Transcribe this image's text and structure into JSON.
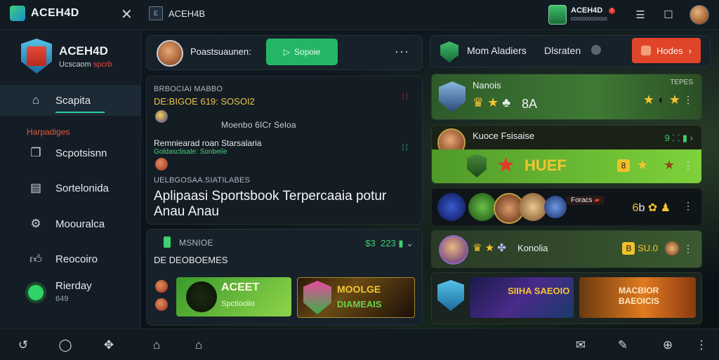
{
  "app": {
    "brand": "ACEH4D",
    "tab_title": "ACEH4B",
    "tab_icon": "E"
  },
  "topbar": {
    "account_name": "ACEH4D",
    "account_sub": "ccccccccccccc",
    "notif_count": "1",
    "icons": [
      "menu-icon",
      "window-icon",
      "profile-avatar"
    ]
  },
  "sidebar": {
    "title": "ACEH4D",
    "subtitle_main": "Ucscaom",
    "subtitle_accent": "spcrb",
    "section": "Harpadiges",
    "items": [
      {
        "label": "Scapita",
        "icon": "home-icon"
      },
      {
        "label": "Scpotsisnn",
        "icon": "copy-icon"
      },
      {
        "label": "Sortelonida",
        "icon": "sheet-icon"
      },
      {
        "label": "Moouralca",
        "icon": "settings-icon"
      },
      {
        "label": "Reocoiro",
        "icon": "thumbs-up-icon"
      },
      {
        "label": "Rierday",
        "sub": "649",
        "icon": "status-dot"
      }
    ]
  },
  "user_row": {
    "name": "Poastsuaunen:",
    "button_label": "Sopoie",
    "more": "···"
  },
  "mid_panel": {
    "label_1": "BRBOCIAI MABBO",
    "yellow_1": "DE:BIGOE 619: SOSOI2",
    "sub_1": "Moenbo 6ICr Seloa",
    "white_2": "Remniearad roan Starsalaria",
    "green_2": "Goldasctisale: Sonbeile",
    "label_3": "UELBGOSAA.SIATILABES",
    "headline": "Aplipaasi Sportsbook Terpercaaia potur Anau Anau"
  },
  "low_panel": {
    "label": "MSNIOE",
    "heading": "DE DEOBOEMES",
    "score_a": "$3",
    "score_b": "223",
    "tile_a_title": "ACEET",
    "tile_a_sub": "Spctioolio",
    "tile_b_title": "MOOLGE",
    "tile_b_sub": "DIAMEAIS"
  },
  "right_panel": {
    "title_1": "Mom Aladiers",
    "title_2": "Dlsraten",
    "cta": "Hodes",
    "row1": {
      "title": "Nanois",
      "right_label": "TEPES",
      "mid_text": "8A"
    },
    "row2": {
      "title": "Kuoce Fsisaise",
      "right_num": "9",
      "band_text": "HUEF"
    },
    "row3": {
      "pill": "Foracs"
    },
    "row4": {
      "title": "Konolia",
      "right_text": "SU.0"
    },
    "row5": {
      "tile_a": "SIIHA SAEOIO",
      "tile_b": "MACBIOR BAEOICIS"
    }
  },
  "bottombar": {
    "icons": [
      "back-icon",
      "chat-icon",
      "gamepad-icon",
      "home-icon",
      "house-icon",
      "mail-icon",
      "tools-icon",
      "globe-icon",
      "more-icon"
    ]
  },
  "colors": {
    "accent_green": "#25b566",
    "accent_orange": "#e0452a",
    "gold": "#f4c431",
    "danger": "#e14a3a"
  }
}
